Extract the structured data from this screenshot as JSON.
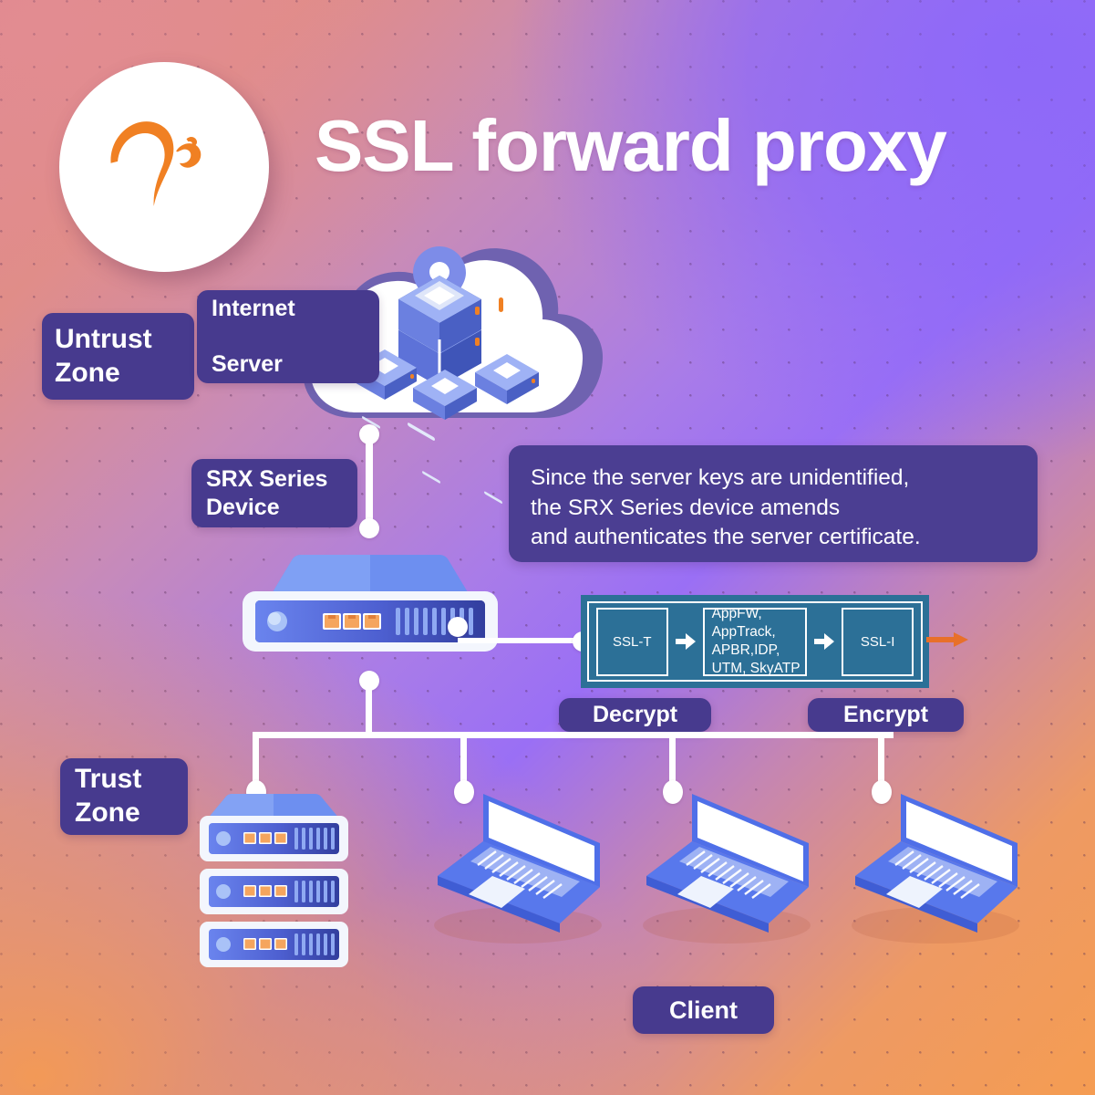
{
  "title": "SSL forward proxy",
  "logo": {
    "name": "juniper-networks-logo",
    "color": "#f08023"
  },
  "labels": {
    "untrust_zone": "Untrust\nZone",
    "internet_server": "Internet\n\nServer",
    "srx_series_device": "SRX Series\nDevice",
    "trust_zone": "Trust\nZone",
    "decrypt": "Decrypt",
    "encrypt": "Encrypt",
    "client": "Client"
  },
  "callout": {
    "line1": "Since the server keys are unidentified,",
    "line2": "the SRX Series device amends",
    "line3": "and authenticates the server certificate."
  },
  "pipeline": {
    "panel_color": "#2c7097",
    "stages": [
      {
        "id": "ssl-t",
        "label": "SSL-T"
      },
      {
        "id": "services",
        "label": "AppFW,\nAppTrack,\nAPBR,IDP,\nUTM, SkyATP"
      },
      {
        "id": "ssl-i",
        "label": "SSL-I"
      }
    ],
    "exit_arrow_color": "#e8702a"
  },
  "colors": {
    "pill_purple": "#473a8e",
    "callout_purple": "#4b3e92",
    "accent_orange": "#f08023",
    "device_blue": "#5678e8",
    "bg_gradient_start": "#e0898f",
    "bg_gradient_purple": "#8d68f9",
    "bg_gradient_orange": "#f49a52"
  },
  "nodes": {
    "cloud": "internet-cloud",
    "srx_device": "srx-series-appliance",
    "server_stack": "trust-zone-server-stack",
    "clients": [
      "client-laptop-1",
      "client-laptop-2",
      "client-laptop-3"
    ]
  }
}
